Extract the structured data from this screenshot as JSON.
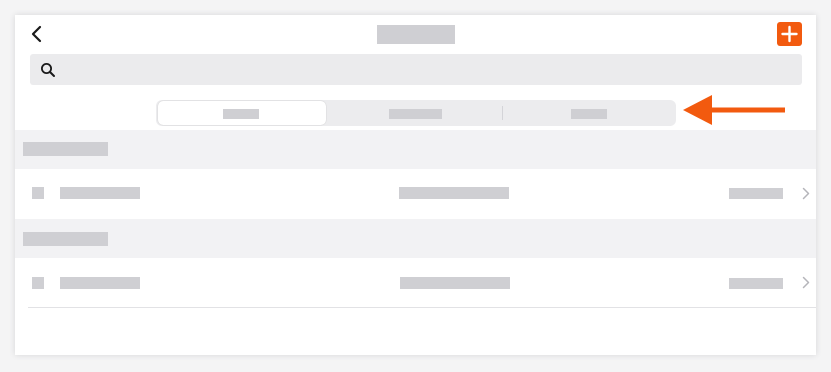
{
  "colors": {
    "accent": "#f25a0f",
    "placeholder": "#cfcfd3",
    "section_background": "#f2f2f4",
    "search_background": "#ebebed"
  },
  "header": {
    "back_icon": "chevron-left-icon",
    "add_icon": "plus-icon"
  },
  "search": {
    "icon": "search-icon",
    "value": "",
    "placeholder": ""
  },
  "segmented_control": {
    "options_count": 3,
    "selected_index": 0
  },
  "sections": [
    {
      "rows": [
        {
          "chevron_icon": "chevron-right-icon"
        }
      ]
    },
    {
      "rows": [
        {
          "chevron_icon": "chevron-right-icon"
        }
      ]
    }
  ],
  "callout": {
    "icon": "arrow-left-icon",
    "color": "#f25a0f"
  }
}
